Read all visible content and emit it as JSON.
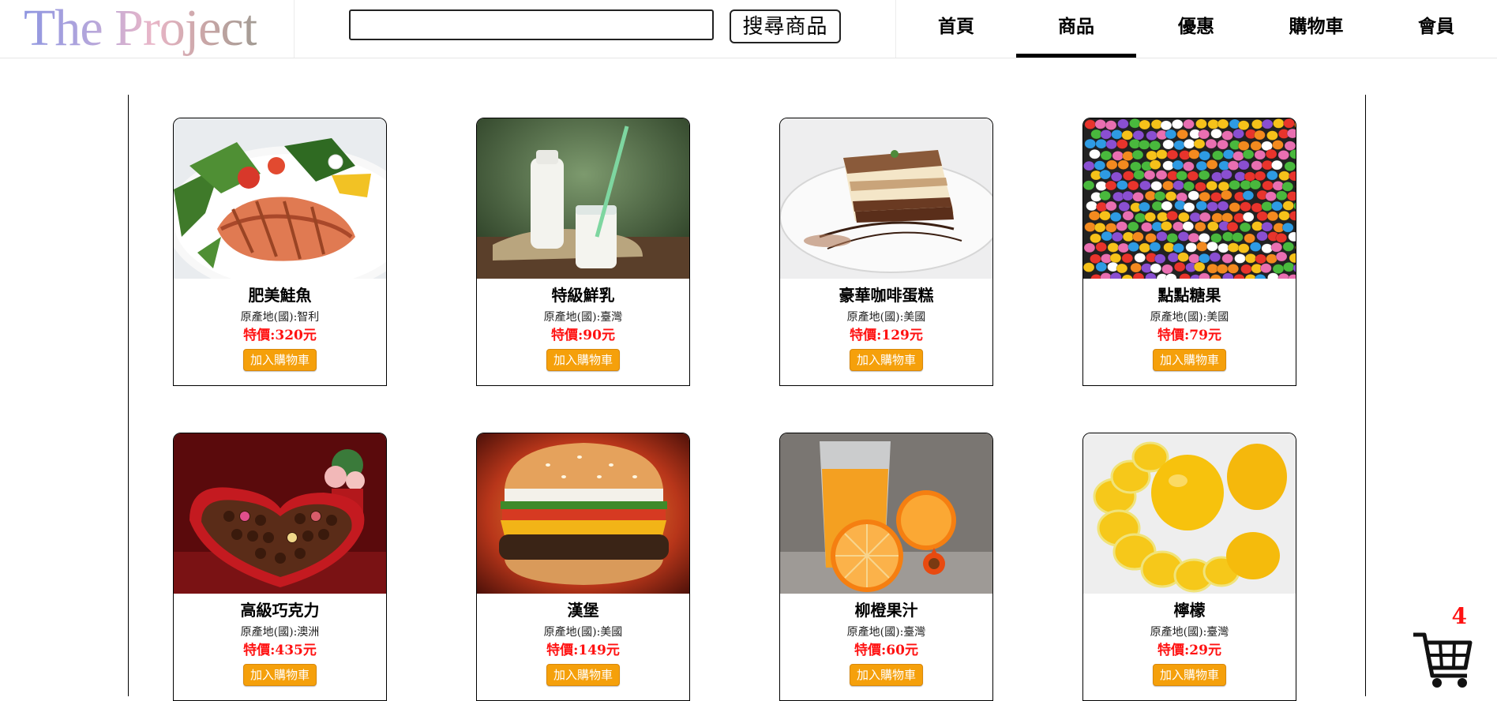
{
  "logo": {
    "text": "The Project"
  },
  "search": {
    "value": "",
    "placeholder": "",
    "button_label": "搜尋商品"
  },
  "nav": {
    "items": [
      {
        "label": "首頁"
      },
      {
        "label": "商品"
      },
      {
        "label": "優惠"
      },
      {
        "label": "購物車"
      },
      {
        "label": "會員"
      }
    ],
    "active_index": 1
  },
  "products": [
    {
      "name": "肥美鮭魚",
      "origin": "原產地(國):智利",
      "price": "特價:320元",
      "button": "加入購物車",
      "image": "salmon"
    },
    {
      "name": "特級鮮乳",
      "origin": "原產地(國):臺灣",
      "price": "特價:90元",
      "button": "加入購物車",
      "image": "milk"
    },
    {
      "name": "豪華咖啡蛋糕",
      "origin": "原產地(國):美國",
      "price": "特價:129元",
      "button": "加入購物車",
      "image": "cake"
    },
    {
      "name": "點點糖果",
      "origin": "原產地(國):美國",
      "price": "特價:79元",
      "button": "加入購物車",
      "image": "candy"
    },
    {
      "name": "高級巧克力",
      "origin": "原產地(國):澳洲",
      "price": "特價:435元",
      "button": "加入購物車",
      "image": "chocolate"
    },
    {
      "name": "漢堡",
      "origin": "原產地(國):美國",
      "price": "特價:149元",
      "button": "加入購物車",
      "image": "burger"
    },
    {
      "name": "柳橙果汁",
      "origin": "原產地(國):臺灣",
      "price": "特價:60元",
      "button": "加入購物車",
      "image": "orange-juice"
    },
    {
      "name": "檸檬",
      "origin": "原產地(國):臺灣",
      "price": "特價:29元",
      "button": "加入購物車",
      "image": "lemon"
    }
  ],
  "cart": {
    "count": "4",
    "icon": "shopping-cart-icon"
  },
  "colors": {
    "accent_button": "#f5a00b",
    "price": "#ff1111",
    "cart_count": "#ff1111"
  }
}
